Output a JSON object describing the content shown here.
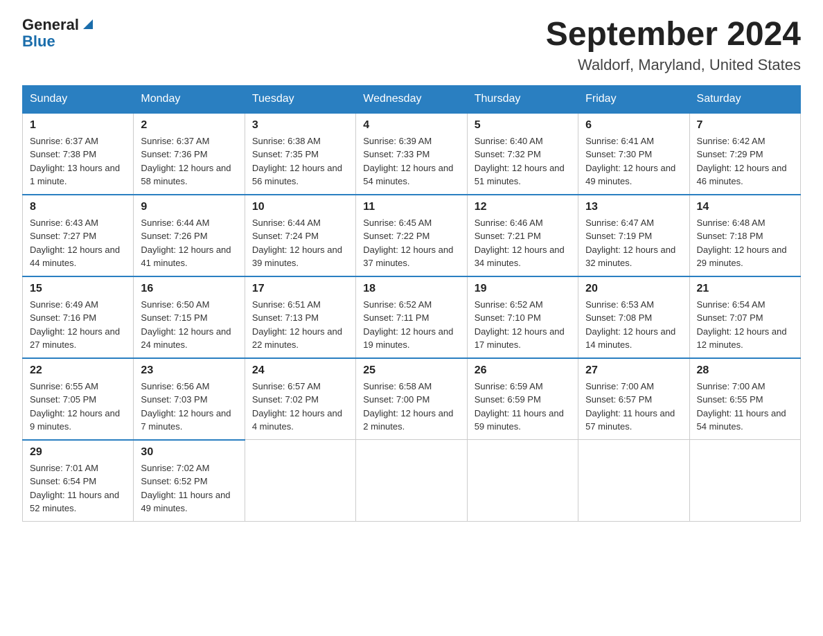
{
  "header": {
    "logo_general": "General",
    "logo_blue": "Blue",
    "title": "September 2024",
    "subtitle": "Waldorf, Maryland, United States"
  },
  "weekdays": [
    "Sunday",
    "Monday",
    "Tuesday",
    "Wednesday",
    "Thursday",
    "Friday",
    "Saturday"
  ],
  "weeks": [
    [
      {
        "day": "1",
        "sunrise": "6:37 AM",
        "sunset": "7:38 PM",
        "daylight": "13 hours and 1 minute."
      },
      {
        "day": "2",
        "sunrise": "6:37 AM",
        "sunset": "7:36 PM",
        "daylight": "12 hours and 58 minutes."
      },
      {
        "day": "3",
        "sunrise": "6:38 AM",
        "sunset": "7:35 PM",
        "daylight": "12 hours and 56 minutes."
      },
      {
        "day": "4",
        "sunrise": "6:39 AM",
        "sunset": "7:33 PM",
        "daylight": "12 hours and 54 minutes."
      },
      {
        "day": "5",
        "sunrise": "6:40 AM",
        "sunset": "7:32 PM",
        "daylight": "12 hours and 51 minutes."
      },
      {
        "day": "6",
        "sunrise": "6:41 AM",
        "sunset": "7:30 PM",
        "daylight": "12 hours and 49 minutes."
      },
      {
        "day": "7",
        "sunrise": "6:42 AM",
        "sunset": "7:29 PM",
        "daylight": "12 hours and 46 minutes."
      }
    ],
    [
      {
        "day": "8",
        "sunrise": "6:43 AM",
        "sunset": "7:27 PM",
        "daylight": "12 hours and 44 minutes."
      },
      {
        "day": "9",
        "sunrise": "6:44 AM",
        "sunset": "7:26 PM",
        "daylight": "12 hours and 41 minutes."
      },
      {
        "day": "10",
        "sunrise": "6:44 AM",
        "sunset": "7:24 PM",
        "daylight": "12 hours and 39 minutes."
      },
      {
        "day": "11",
        "sunrise": "6:45 AM",
        "sunset": "7:22 PM",
        "daylight": "12 hours and 37 minutes."
      },
      {
        "day": "12",
        "sunrise": "6:46 AM",
        "sunset": "7:21 PM",
        "daylight": "12 hours and 34 minutes."
      },
      {
        "day": "13",
        "sunrise": "6:47 AM",
        "sunset": "7:19 PM",
        "daylight": "12 hours and 32 minutes."
      },
      {
        "day": "14",
        "sunrise": "6:48 AM",
        "sunset": "7:18 PM",
        "daylight": "12 hours and 29 minutes."
      }
    ],
    [
      {
        "day": "15",
        "sunrise": "6:49 AM",
        "sunset": "7:16 PM",
        "daylight": "12 hours and 27 minutes."
      },
      {
        "day": "16",
        "sunrise": "6:50 AM",
        "sunset": "7:15 PM",
        "daylight": "12 hours and 24 minutes."
      },
      {
        "day": "17",
        "sunrise": "6:51 AM",
        "sunset": "7:13 PM",
        "daylight": "12 hours and 22 minutes."
      },
      {
        "day": "18",
        "sunrise": "6:52 AM",
        "sunset": "7:11 PM",
        "daylight": "12 hours and 19 minutes."
      },
      {
        "day": "19",
        "sunrise": "6:52 AM",
        "sunset": "7:10 PM",
        "daylight": "12 hours and 17 minutes."
      },
      {
        "day": "20",
        "sunrise": "6:53 AM",
        "sunset": "7:08 PM",
        "daylight": "12 hours and 14 minutes."
      },
      {
        "day": "21",
        "sunrise": "6:54 AM",
        "sunset": "7:07 PM",
        "daylight": "12 hours and 12 minutes."
      }
    ],
    [
      {
        "day": "22",
        "sunrise": "6:55 AM",
        "sunset": "7:05 PM",
        "daylight": "12 hours and 9 minutes."
      },
      {
        "day": "23",
        "sunrise": "6:56 AM",
        "sunset": "7:03 PM",
        "daylight": "12 hours and 7 minutes."
      },
      {
        "day": "24",
        "sunrise": "6:57 AM",
        "sunset": "7:02 PM",
        "daylight": "12 hours and 4 minutes."
      },
      {
        "day": "25",
        "sunrise": "6:58 AM",
        "sunset": "7:00 PM",
        "daylight": "12 hours and 2 minutes."
      },
      {
        "day": "26",
        "sunrise": "6:59 AM",
        "sunset": "6:59 PM",
        "daylight": "11 hours and 59 minutes."
      },
      {
        "day": "27",
        "sunrise": "7:00 AM",
        "sunset": "6:57 PM",
        "daylight": "11 hours and 57 minutes."
      },
      {
        "day": "28",
        "sunrise": "7:00 AM",
        "sunset": "6:55 PM",
        "daylight": "11 hours and 54 minutes."
      }
    ],
    [
      {
        "day": "29",
        "sunrise": "7:01 AM",
        "sunset": "6:54 PM",
        "daylight": "11 hours and 52 minutes."
      },
      {
        "day": "30",
        "sunrise": "7:02 AM",
        "sunset": "6:52 PM",
        "daylight": "11 hours and 49 minutes."
      },
      null,
      null,
      null,
      null,
      null
    ]
  ]
}
